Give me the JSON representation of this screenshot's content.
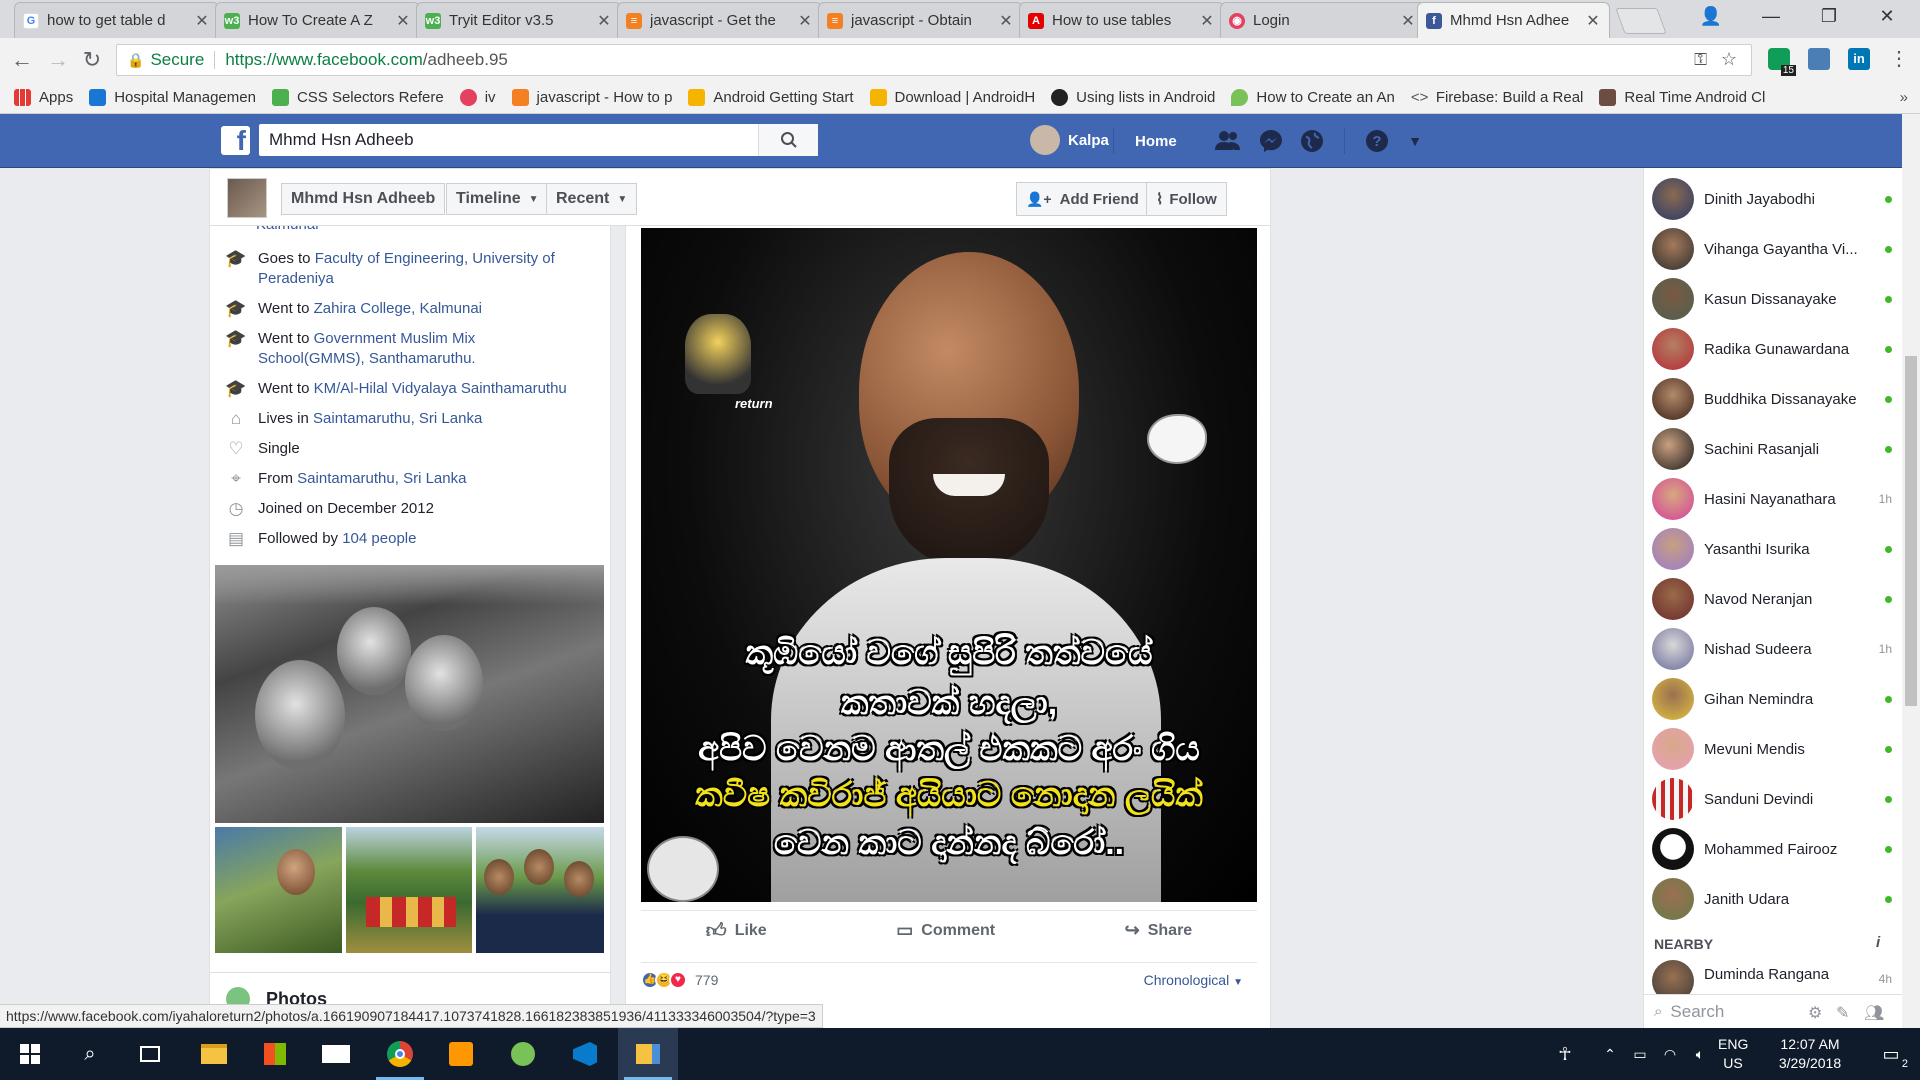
{
  "browser": {
    "tabs": [
      {
        "title": "how to get table d",
        "icon": "google-icon"
      },
      {
        "title": "How To Create A Z",
        "icon": "w3schools-icon"
      },
      {
        "title": "Tryit Editor v3.5",
        "icon": "w3schools-icon"
      },
      {
        "title": "javascript - Get the",
        "icon": "stackoverflow-icon"
      },
      {
        "title": "javascript - Obtain",
        "icon": "stackoverflow-icon"
      },
      {
        "title": "How to use tables",
        "icon": "adobe-icon"
      },
      {
        "title": "Login",
        "icon": "login-icon"
      },
      {
        "title": "Mhmd Hsn Adhee",
        "icon": "facebook-icon"
      }
    ],
    "address": {
      "secure_label": "Secure",
      "url_host": "https://www.facebook.com",
      "url_path": "/adheeb.95"
    },
    "extension_badges": {
      "first": "15"
    },
    "bookmarks": [
      {
        "label": "Apps"
      },
      {
        "label": "Hospital Managemen"
      },
      {
        "label": "CSS Selectors Refere"
      },
      {
        "label": "iv"
      },
      {
        "label": "javascript - How to p"
      },
      {
        "label": "Android Getting Start"
      },
      {
        "label": "Download | AndroidH"
      },
      {
        "label": "Using lists in Android"
      },
      {
        "label": "How to Create an An"
      },
      {
        "label": "Firebase: Build a Real"
      },
      {
        "label": "Real Time Android Cl"
      }
    ],
    "status_url": "https://www.facebook.com/iyahalo​return2/photos/a.166190907184417.1073741828.166182383851936/411333346003504/?type=3"
  },
  "fb_header": {
    "search_value": "Mhmd Hsn Adheeb",
    "user_name": "Kalpa",
    "home_label": "Home"
  },
  "profile_nav": {
    "name": "Mhmd Hsn Adheeb",
    "timeline": "Timeline",
    "recent": "Recent",
    "add_friend": "Add Friend",
    "follow": "Follow"
  },
  "intro": {
    "cut_text": "Kalmunai",
    "items": [
      {
        "prefix": "Goes to ",
        "link": "Faculty of Engineering, University of Peradeniya",
        "icon": "graduation-cap-icon"
      },
      {
        "prefix": "Went to ",
        "link": "Zahira College, Kalmunai",
        "icon": "graduation-cap-icon"
      },
      {
        "prefix": "Went to ",
        "link": "Government Muslim Mix School(GMMS), Santhamaruthu.",
        "icon": "graduation-cap-icon"
      },
      {
        "prefix": "Went to ",
        "link": "KM/Al-Hilal Vidyalaya Sainthamaruthu",
        "icon": "graduation-cap-icon"
      },
      {
        "prefix": "Lives in ",
        "link": "Saintamaruthu, Sri Lanka",
        "icon": "home-icon"
      },
      {
        "prefix": "Single",
        "link": "",
        "icon": "heart-icon"
      },
      {
        "prefix": "From ",
        "link": "Saintamaruthu, Sri Lanka",
        "icon": "location-pin-icon"
      },
      {
        "prefix": "Joined on December 2012",
        "link": "",
        "icon": "clock-icon"
      },
      {
        "prefix": "Followed by ",
        "link": "104 people",
        "icon": "rss-icon"
      }
    ],
    "photos_heading": "Photos"
  },
  "post": {
    "image_text_lines": [
      "කූඹියෝ වගේ සුපිරි තත්වයේ",
      "කතාවක් හදලා,",
      "අපිව වෙනම ආතල් එකකට අරං ගිය",
      "කවීෂ කවිරාජ් අයියාට නොදාන ලයික්",
      "වෙන කාට දාන්නද බ්රෝ.."
    ],
    "watermark": "return",
    "like": "Like",
    "comment": "Comment",
    "share": "Share",
    "reaction_count": "779",
    "sort": "Chronological"
  },
  "chat": {
    "friends": [
      {
        "name": "Dinith Jayabodhi",
        "status": "online",
        "time": ""
      },
      {
        "name": "Vihanga Gayantha Vi...",
        "status": "online",
        "time": ""
      },
      {
        "name": "Kasun Dissanayake",
        "status": "online",
        "time": ""
      },
      {
        "name": "Radika Gunawardana",
        "status": "online",
        "time": ""
      },
      {
        "name": "Buddhika Dissanayake",
        "status": "online",
        "time": ""
      },
      {
        "name": "Sachini Rasanjali",
        "status": "online",
        "time": ""
      },
      {
        "name": "Hasini Nayanathara",
        "status": "idle",
        "time": "1h"
      },
      {
        "name": "Yasanthi Isurika",
        "status": "online",
        "time": ""
      },
      {
        "name": "Navod Neranjan",
        "status": "online",
        "time": ""
      },
      {
        "name": "Nishad Sudeera",
        "status": "idle",
        "time": "1h"
      },
      {
        "name": "Gihan Nemindra",
        "status": "online",
        "time": ""
      },
      {
        "name": "Mevuni Mendis",
        "status": "online",
        "time": ""
      },
      {
        "name": "Sanduni Devindi",
        "status": "online",
        "time": ""
      },
      {
        "name": "Mohammed Fairooz",
        "status": "online",
        "time": ""
      },
      {
        "name": "Janith Udara",
        "status": "online",
        "time": ""
      }
    ],
    "nearby_label": "NEARBY",
    "nearby": [
      {
        "name": "Duminda Rangana",
        "time": "4h"
      }
    ],
    "search_placeholder": "Search"
  },
  "taskbar": {
    "lang_top": "ENG",
    "lang_bottom": "US",
    "time": "12:07 AM",
    "date": "3/29/2018",
    "notifications": "2"
  },
  "colors": {
    "fb_blue": "#4267b2",
    "link": "#365899",
    "online": "#42b72a"
  }
}
